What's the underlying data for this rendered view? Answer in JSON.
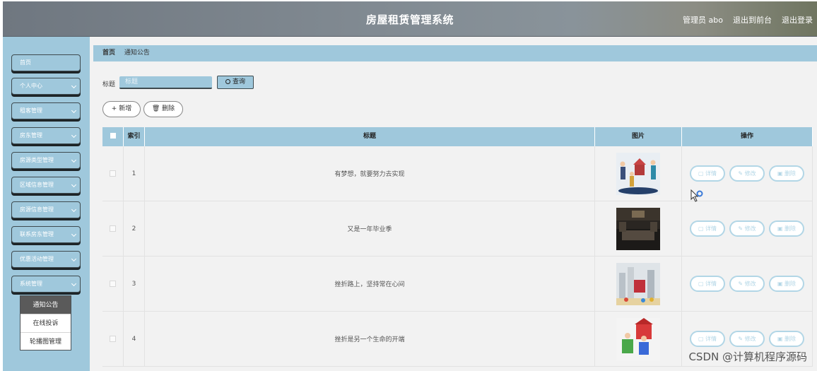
{
  "header": {
    "title": "房屋租赁管理系统",
    "admin": "管理员 abo",
    "to_front": "退出到前台",
    "logout": "退出登录"
  },
  "sidebar": {
    "items": [
      {
        "label": "首页"
      },
      {
        "label": "个人中心"
      },
      {
        "label": "租客管理"
      },
      {
        "label": "房东管理"
      },
      {
        "label": "房源类型管理"
      },
      {
        "label": "区域信息管理"
      },
      {
        "label": "房源信息管理"
      },
      {
        "label": "联系房东管理"
      },
      {
        "label": "优惠活动管理"
      },
      {
        "label": "系统管理"
      }
    ],
    "submenu": [
      {
        "label": "通知公告",
        "active": true
      },
      {
        "label": "在线投诉"
      },
      {
        "label": "轮播图管理"
      }
    ]
  },
  "breadcrumb": {
    "home": "首页",
    "current": "通知公告"
  },
  "search": {
    "label": "标题",
    "placeholder": "标题",
    "button": "查询"
  },
  "toolbar": {
    "add": "新增",
    "delete": "删除"
  },
  "table": {
    "headers": {
      "index": "索引",
      "title": "标题",
      "image": "图片",
      "actions": "操作"
    },
    "rows": [
      {
        "index": "1",
        "title": "有梦想，就要努力去实现"
      },
      {
        "index": "2",
        "title": "又是一年毕业季"
      },
      {
        "index": "3",
        "title": "挫折路上，坚持常在心间"
      },
      {
        "index": "4",
        "title": "挫折是另一个生命的开端"
      }
    ],
    "actions": {
      "detail": "详情",
      "edit": "修改",
      "delete": "删除"
    }
  },
  "watermark": "CSDN @计算机程序源码"
}
